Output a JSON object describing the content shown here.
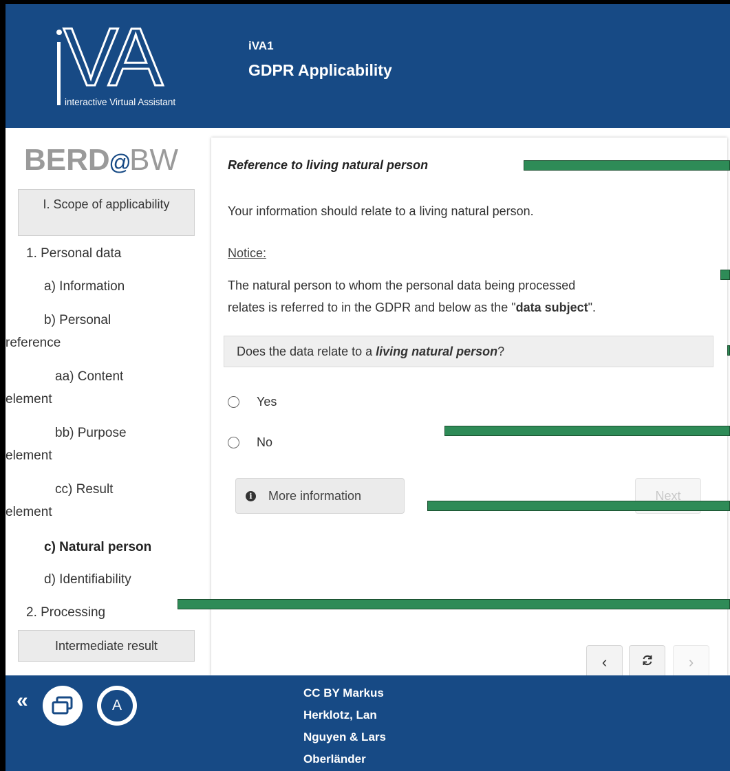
{
  "header": {
    "logo_text": "iVA",
    "logo_subtitle": "interactive Virtual Assistant",
    "code": "iVA1",
    "title": "GDPR Applicability"
  },
  "sidebar": {
    "brand_left": "BERD",
    "brand_at": "@",
    "brand_right": "BW",
    "section_label": "I. Scope of applicability",
    "items": [
      {
        "label": "1. Personal data"
      },
      {
        "label": "a) Information"
      },
      {
        "label": "b) Personal"
      },
      {
        "label": "reference"
      },
      {
        "label": "aa) Content"
      },
      {
        "label": "element"
      },
      {
        "label": "bb) Purpose"
      },
      {
        "label": "element"
      },
      {
        "label": "cc) Result"
      },
      {
        "label": "element"
      },
      {
        "label": "c) Natural person"
      },
      {
        "label": "d) Identifiability"
      },
      {
        "label": "2. Processing"
      }
    ],
    "intermediate_label": "Intermediate result"
  },
  "content": {
    "heading": "Reference to living natural person",
    "intro": "Your information should relate to a living natural person.",
    "notice_label": "Notice:",
    "notice_line1": "The natural person to whom the personal data being processed",
    "notice_line2_a": "relates is referred to in the GDPR and below as the \"",
    "notice_line2_bold": "data subject",
    "notice_line2_b": "\".",
    "question_a": "Does the data relate to a ",
    "question_em": "living natural person",
    "question_b": "?",
    "options": [
      {
        "label": "Yes",
        "selected": false
      },
      {
        "label": "No",
        "selected": false
      }
    ],
    "more_info_label": "More information",
    "next_label": "Next",
    "prev_icon": "chevron-left-icon",
    "reload_icon": "refresh-icon",
    "forward_icon": "chevron-right-icon"
  },
  "footer": {
    "credit_lines": [
      "CC BY Markus",
      "Herklotz, Lan",
      "Nguyen & Lars",
      "Oberländer"
    ],
    "icons": [
      "double-chevron-left-icon",
      "windows-icon",
      "a-icon"
    ],
    "a_label": "A"
  },
  "colors": {
    "brand_blue": "#174a85",
    "marker_green": "#2e8b57"
  }
}
